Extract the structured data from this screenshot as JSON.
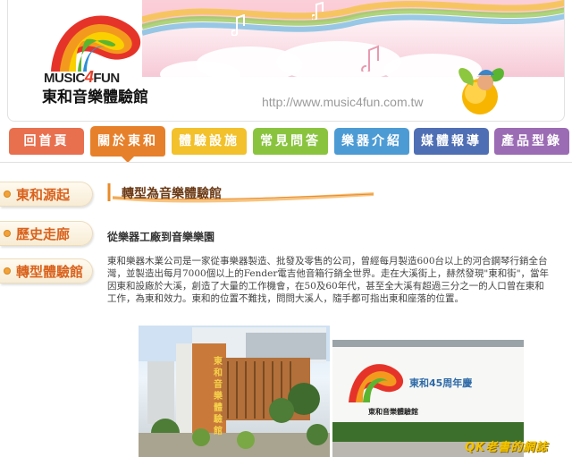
{
  "header": {
    "logo_brand_pre": "MUSIC",
    "logo_brand_num": "4",
    "logo_brand_post": "FUN",
    "logo_name": "東和音樂體驗館",
    "url": "http://www.music4fun.com.tw"
  },
  "nav": {
    "tabs": [
      {
        "label": "回首頁",
        "color": "#e8704f",
        "active": false
      },
      {
        "label": "關於東和",
        "color": "#e7802a",
        "active": true
      },
      {
        "label": "體驗設施",
        "color": "#f2c12b",
        "active": false
      },
      {
        "label": "常見問答",
        "color": "#8ac43f",
        "active": false
      },
      {
        "label": "樂器介紹",
        "color": "#4c9bd4",
        "active": false
      },
      {
        "label": "媒體報導",
        "color": "#4f6fb5",
        "active": false
      },
      {
        "label": "產品型錄",
        "color": "#9b6bb4",
        "active": false
      }
    ]
  },
  "sidebar": {
    "items": [
      {
        "label": "東和源起"
      },
      {
        "label": "歷史走廊"
      },
      {
        "label": "轉型體驗館"
      }
    ]
  },
  "main": {
    "section_title": "轉型為音樂體驗館",
    "subhead": "從樂器工廠到音樂樂園",
    "paragraph": "東和樂器木業公司是一家從事樂器製造、批發及零售的公司，曾經每月製造600台以上的河合鋼琴行銷全台灣，並製造出每月7000個以上的Fender電吉他音箱行銷全世界。走在大溪街上，赫然發現\"東和街\"，當年因東和設廠於大溪，創造了大量的工作機會，在50及60年代，甚至全大溪有超過三分之一的人口曾在東和工作，為東和效力。東和的位置不難找，問問大溪人，隨手都可指出東和座落的位置。"
  },
  "photos": {
    "photo1_sign": "東和音樂體驗館",
    "photo2_sign": "東和45周年慶",
    "photo2_logo": "東和音樂體驗館"
  },
  "watermark": "QK老書的網誌"
}
